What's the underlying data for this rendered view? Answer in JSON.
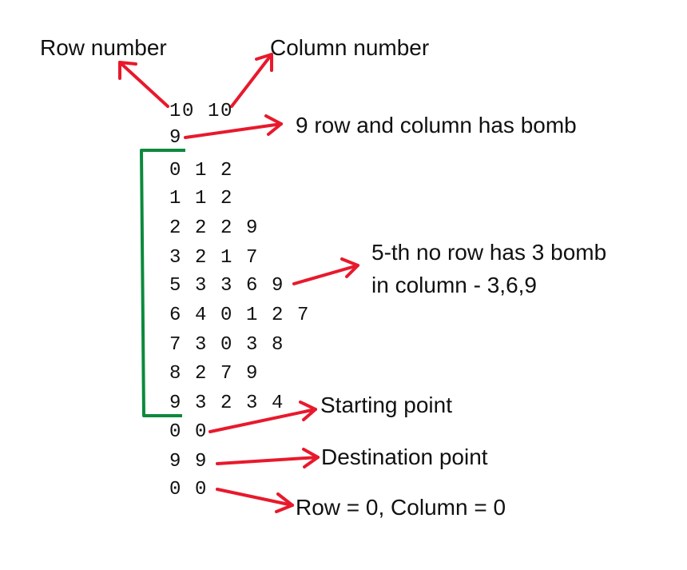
{
  "labels": {
    "row_number": "Row number",
    "column_number": "Column number",
    "bomb_count": "9 row and column has bomb",
    "row5_line1": "5-th no row has 3 bomb",
    "row5_line2": "in column - 3,6,9",
    "starting_point": "Starting point",
    "destination_point": "Destination point",
    "row_column": "Row = 0, Column = 0"
  },
  "input": {
    "dimensions": "10 10",
    "bomb_rows": "9",
    "rows": [
      "0 1 2",
      "1 1 2",
      "2 2 2 9",
      "3 2 1 7",
      "5 3 3 6 9",
      "6 4 0 1 2 7",
      "7 3 0 3 8",
      "8 2 7 9",
      "9 3 2 3 4"
    ],
    "start": "0 0",
    "destination": "9 9",
    "last": "0 0"
  },
  "colors": {
    "arrow": "#e8192c",
    "bracket": "#0b8a3c",
    "text": "#111111"
  }
}
